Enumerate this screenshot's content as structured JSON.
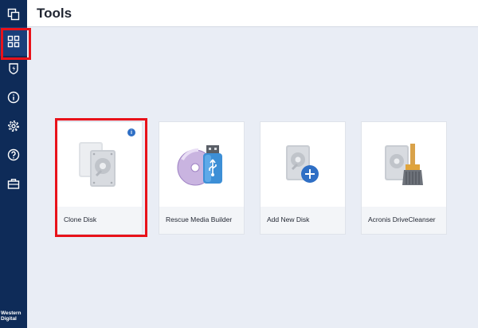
{
  "app": {
    "title": "Tools"
  },
  "sidebar": {
    "items": [
      {
        "icon": "clone-tabs-icon"
      },
      {
        "icon": "grid-tools-icon"
      },
      {
        "icon": "shield-icon"
      },
      {
        "icon": "info-circle-icon"
      },
      {
        "icon": "gear-icon"
      },
      {
        "icon": "help-icon"
      },
      {
        "icon": "briefcase-icon"
      }
    ],
    "brand_line1": "Western",
    "brand_line2": "Digital"
  },
  "tools": [
    {
      "label": "Clone Disk",
      "icon": "clone-disk-icon",
      "has_info": true,
      "info": "i"
    },
    {
      "label": "Rescue Media Builder",
      "icon": "rescue-media-icon"
    },
    {
      "label": "Add New Disk",
      "icon": "add-disk-icon"
    },
    {
      "label": "Acronis DriveCleanser",
      "icon": "drive-cleanser-icon"
    }
  ],
  "colors": {
    "sidebar": "#0e2b58",
    "accent": "#2f6fc5",
    "highlight": "#e8121a",
    "content_bg": "#e9edf5"
  }
}
